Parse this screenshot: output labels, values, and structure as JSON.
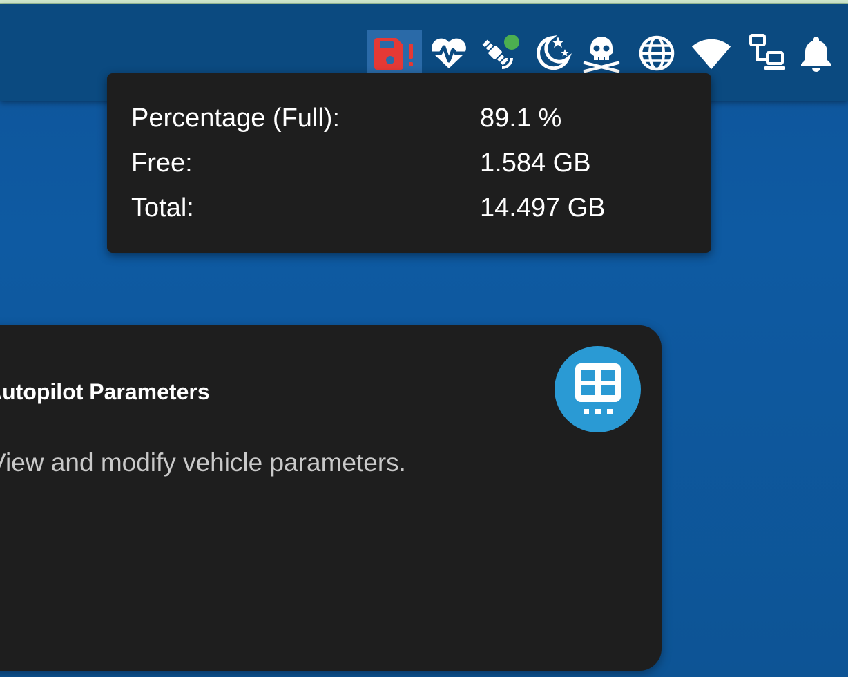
{
  "colors": {
    "background": "#0f5499",
    "app_bar": "#0b4a80",
    "tooltip_bg": "#1e1e1e",
    "card_bg": "#1e1e1e",
    "disk_warning": "#e53935",
    "online_dot": "#4caf50",
    "card_badge": "#2a9ad4"
  },
  "tray_icons": [
    {
      "name": "disk-warning-icon",
      "state": "warning",
      "selected": true
    },
    {
      "name": "heartbeat-icon"
    },
    {
      "name": "satellite-icon",
      "status_dot": "online"
    },
    {
      "name": "night-mode-icon"
    },
    {
      "name": "skull-icon"
    },
    {
      "name": "globe-icon"
    },
    {
      "name": "wifi-icon"
    },
    {
      "name": "network-icon"
    },
    {
      "name": "bell-icon"
    }
  ],
  "disk_tooltip": {
    "rows": [
      {
        "label": "Percentage (Full):",
        "value": "89.1 %"
      },
      {
        "label": "Free:",
        "value": "1.584 GB"
      },
      {
        "label": "Total:",
        "value": "14.497 GB"
      }
    ]
  },
  "card": {
    "title": "Autopilot Parameters",
    "description": "View and modify vehicle parameters.",
    "icon": "parameters-table-icon"
  }
}
